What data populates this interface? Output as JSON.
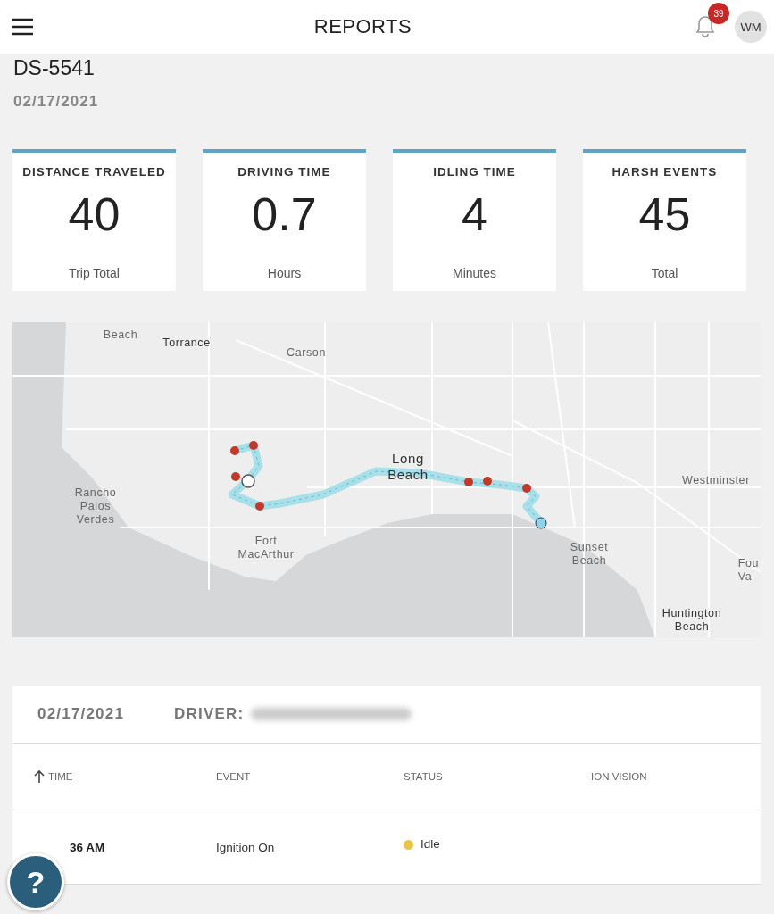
{
  "header": {
    "title": "REPORTS",
    "notification_count": "39",
    "user_initials": "WM"
  },
  "vehicle": {
    "id": "DS-5541",
    "date": "02/17/2021"
  },
  "stats": [
    {
      "label": "DISTANCE TRAVELED",
      "value": "40",
      "unit": "Trip Total"
    },
    {
      "label": "DRIVING TIME",
      "value": "0.7",
      "unit": "Hours"
    },
    {
      "label": "IDLING TIME",
      "value": "4",
      "unit": "Minutes"
    },
    {
      "label": "HARSH EVENTS",
      "value": "45",
      "unit": "Total"
    }
  ],
  "map": {
    "labels": [
      "Beach",
      "Torrance",
      "Carson",
      "Long Beach",
      "Rancho Palos Verdes",
      "Fort MacArthur",
      "Westminster",
      "Sunset Beach",
      "Huntington Beach",
      "Fou Va"
    ]
  },
  "trip_table": {
    "date": "02/17/2021",
    "driver_label": "DRIVER:",
    "columns": [
      {
        "label": "TIME",
        "sorted": true
      },
      {
        "label": "EVENT",
        "sorted": false
      },
      {
        "label": "STATUS",
        "sorted": false
      },
      {
        "label": "ION VISION",
        "sorted": false
      }
    ],
    "rows": [
      {
        "time": "36 AM",
        "event": "Ignition On",
        "status": "Idle",
        "color": "#e8c547"
      }
    ]
  },
  "help_button": {
    "label": "?"
  }
}
